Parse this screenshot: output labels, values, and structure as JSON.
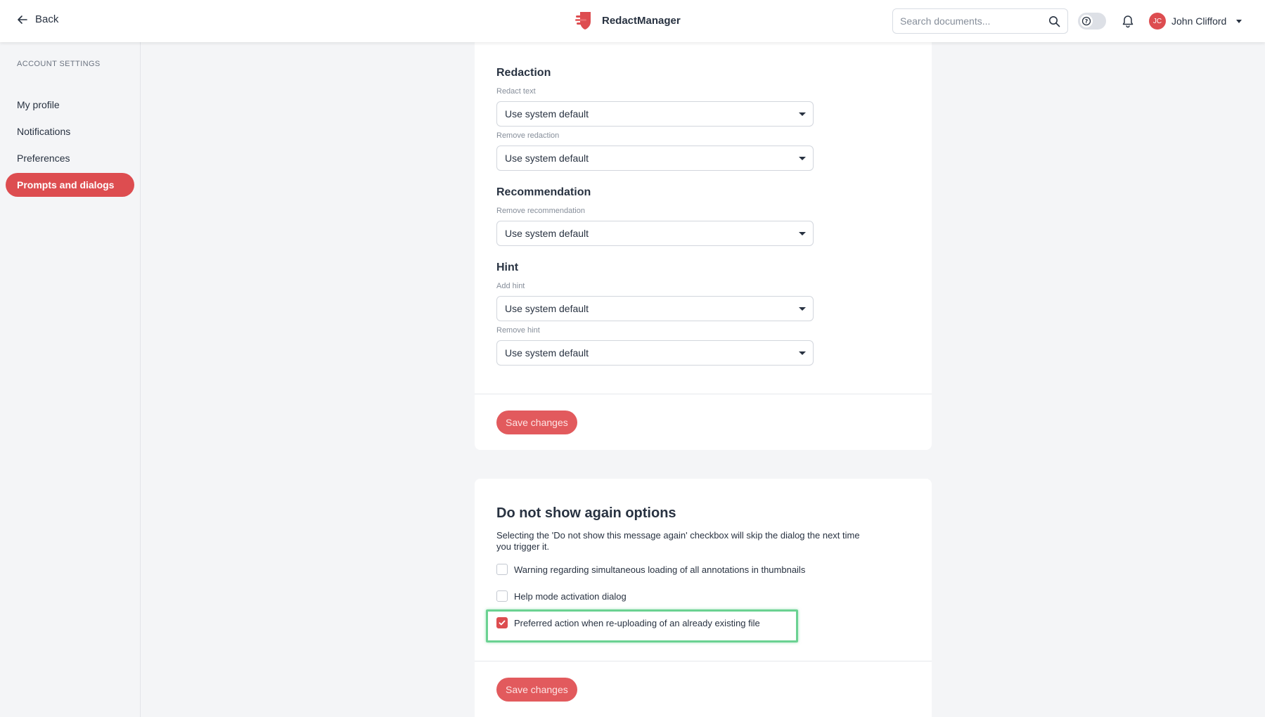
{
  "header": {
    "back_label": "Back",
    "brand_name": "RedactManager",
    "search": {
      "placeholder": "Search documents...",
      "value": ""
    },
    "user": {
      "initials": "JC",
      "name": "John Clifford"
    }
  },
  "sidebar": {
    "title": "ACCOUNT SETTINGS",
    "items": [
      {
        "label": "My profile",
        "active": false
      },
      {
        "label": "Notifications",
        "active": false
      },
      {
        "label": "Preferences",
        "active": false
      },
      {
        "label": "Prompts and dialogs",
        "active": true
      }
    ]
  },
  "dialog_settings": {
    "redaction": {
      "title": "Redaction",
      "redact_text": {
        "label": "Redact text",
        "value": "Use system default"
      },
      "remove_redaction": {
        "label": "Remove redaction",
        "value": "Use system default"
      }
    },
    "recommendation": {
      "title": "Recommendation",
      "remove_recommendation": {
        "label": "Remove recommendation",
        "value": "Use system default"
      }
    },
    "hint": {
      "title": "Hint",
      "add_hint": {
        "label": "Add hint",
        "value": "Use system default"
      },
      "remove_hint": {
        "label": "Remove hint",
        "value": "Use system default"
      }
    },
    "save_label": "Save changes"
  },
  "do_not_show": {
    "title": "Do not show again options",
    "description": "Selecting the 'Do not show this message again' checkbox will skip the dialog the next time you trigger it.",
    "options": [
      {
        "label": "Warning regarding simultaneous loading of all annotations in thumbnails",
        "checked": false
      },
      {
        "label": "Help mode activation dialog",
        "checked": false
      },
      {
        "label": "Preferred action when re-uploading of an already existing file",
        "checked": true
      }
    ],
    "save_label": "Save changes"
  },
  "colors": {
    "accent": "#dd4d50",
    "button": "#e25a5d",
    "highlight": "#6bd292",
    "background": "#f4f5f7"
  }
}
